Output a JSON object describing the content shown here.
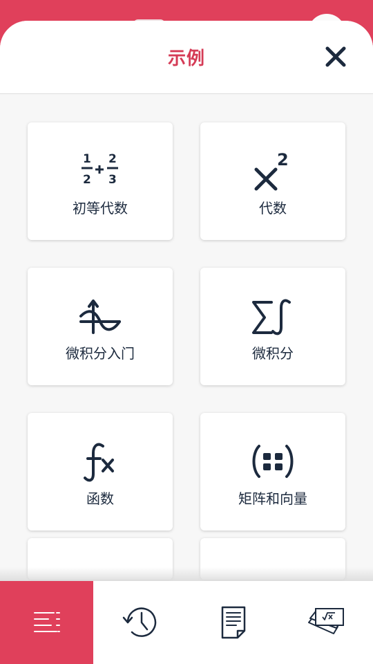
{
  "sheet": {
    "title": "示例"
  },
  "topics": [
    {
      "label": "初等代数",
      "icon": "fraction-addition-icon"
    },
    {
      "label": "代数",
      "icon": "x-squared-icon"
    },
    {
      "label": "微积分入门",
      "icon": "function-graph-icon"
    },
    {
      "label": "微积分",
      "icon": "sum-integral-icon"
    },
    {
      "label": "函数",
      "icon": "fx-icon"
    },
    {
      "label": "矩阵和向量",
      "icon": "matrix-icon"
    }
  ],
  "tabs": [
    {
      "icon": "menu-list-icon",
      "active": true
    },
    {
      "icon": "history-clock-icon",
      "active": false
    },
    {
      "icon": "notes-document-icon",
      "active": false
    },
    {
      "icon": "flashcards-icon",
      "active": false
    }
  ],
  "colors": {
    "accent": "#e0405b",
    "title": "#d53b56",
    "ink": "#1c2a3e",
    "background": "#f7f7f7"
  }
}
